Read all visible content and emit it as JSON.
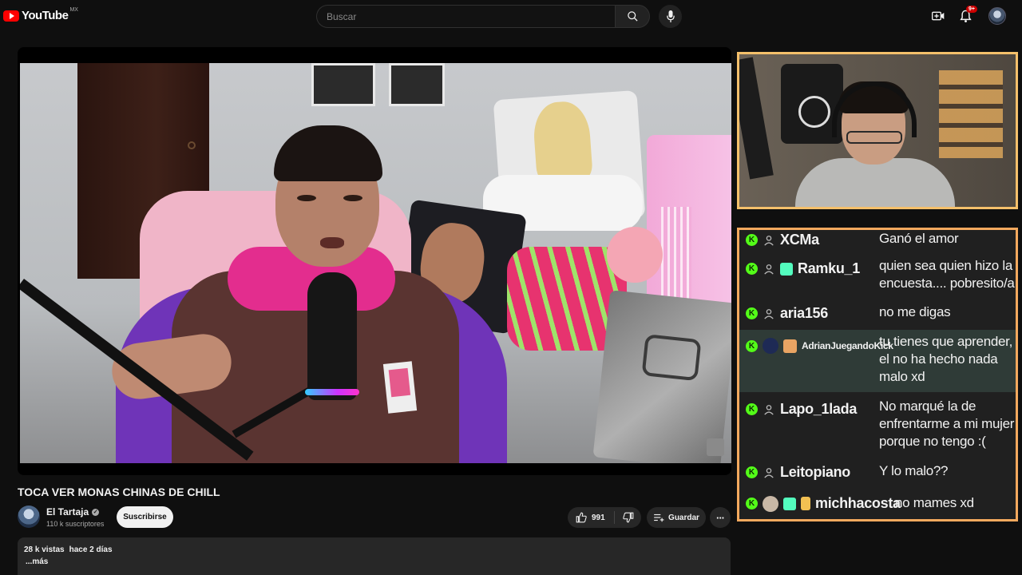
{
  "header": {
    "logo_text": "YouTube",
    "region": "MX",
    "search_placeholder": "Buscar",
    "notification_count": "9+"
  },
  "video": {
    "title": "TOCA VER MONAS CHINAS DE CHILL",
    "channel": "El Tartaja",
    "subscribers": "110 k suscriptores",
    "subscribe_label": "Suscribirse",
    "likes": "991",
    "save_label": "Guardar",
    "views": "28 k vistas",
    "age": "hace 2 días",
    "more_label": "...más"
  },
  "chat": {
    "messages": [
      {
        "user": "XCMa",
        "text": "Ganó el amor"
      },
      {
        "user": "Ramku_1",
        "text": "quien sea quien hizo la encuesta.... pobresito/a"
      },
      {
        "user": "aria156",
        "text": "no me digas"
      },
      {
        "user": "AdrianJuegandoKick",
        "text": "tu tienes que aprender, el no ha hecho nada malo xd"
      },
      {
        "user": "Lapo_1lada",
        "text": "No marqué la de enfrentarme a mi mujer porque no tengo :("
      },
      {
        "user": "Leitopiano",
        "text": "Y lo malo??"
      },
      {
        "user": "michhacosta",
        "text": "no mames xd"
      }
    ]
  },
  "colors": {
    "accent_red": "#ff0000",
    "kick_green": "#53fc18",
    "webcam_border": "#f4c06b",
    "chat_border": "#f4a95e"
  },
  "icons": [
    "search-icon",
    "mic-icon",
    "create-icon",
    "bell-icon",
    "like-icon",
    "dislike-icon",
    "save-icon",
    "more-icon",
    "user-icon",
    "kick-icon"
  ]
}
